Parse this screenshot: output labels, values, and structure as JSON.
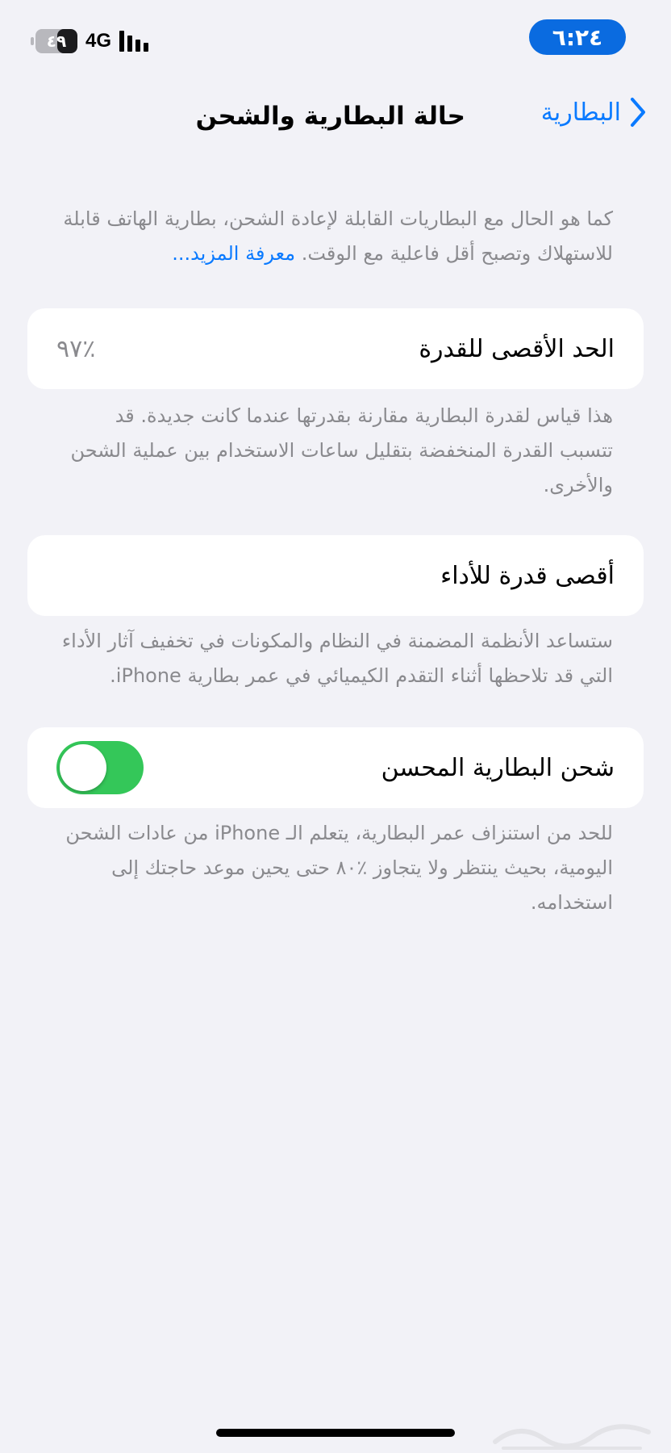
{
  "status_bar": {
    "time": "٦:٢٤",
    "battery_level": "٤٩",
    "battery_fraction": 0.49,
    "network": "4G",
    "signal_bars": 4,
    "accent_color": "#0a6be0"
  },
  "nav": {
    "back_label": "البطارية",
    "title": "حالة البطارية والشحن"
  },
  "intro": {
    "text": "كما هو الحال مع البطاريات القابلة لإعادة الشحن، بطارية الهاتف قابلة للاستهلاك وتصبح أقل فاعلية مع الوقت.",
    "link": "معرفة المزيد..."
  },
  "max_capacity": {
    "label": "الحد الأقصى للقدرة",
    "value": "٪٩٧",
    "description": "هذا قياس لقدرة البطارية مقارنة بقدرتها عندما كانت جديدة. قد تتسبب القدرة المنخفضة بتقليل ساعات الاستخدام بين عملية الشحن والأخرى."
  },
  "peak_performance": {
    "label": "أقصى قدرة للأداء",
    "description": "ستساعد الأنظمة المضمنة في النظام والمكونات في تخفيف آثار الأداء التي قد تلاحظها أثناء التقدم الكيميائي في عمر بطارية iPhone."
  },
  "optimized_charging": {
    "label": "شحن البطارية المحسن",
    "enabled": true,
    "description": "للحد من استنزاف عمر البطارية، يتعلم الـ iPhone من عادات الشحن اليومية، بحيث ينتظر ولا يتجاوز ٪٨٠ حتى يحين موعد حاجتك إلى استخدامه."
  },
  "colors": {
    "background": "#f2f2f7",
    "link": "#0a7aff",
    "toggle_on": "#34c759",
    "secondary_text": "#8a8a8e"
  }
}
